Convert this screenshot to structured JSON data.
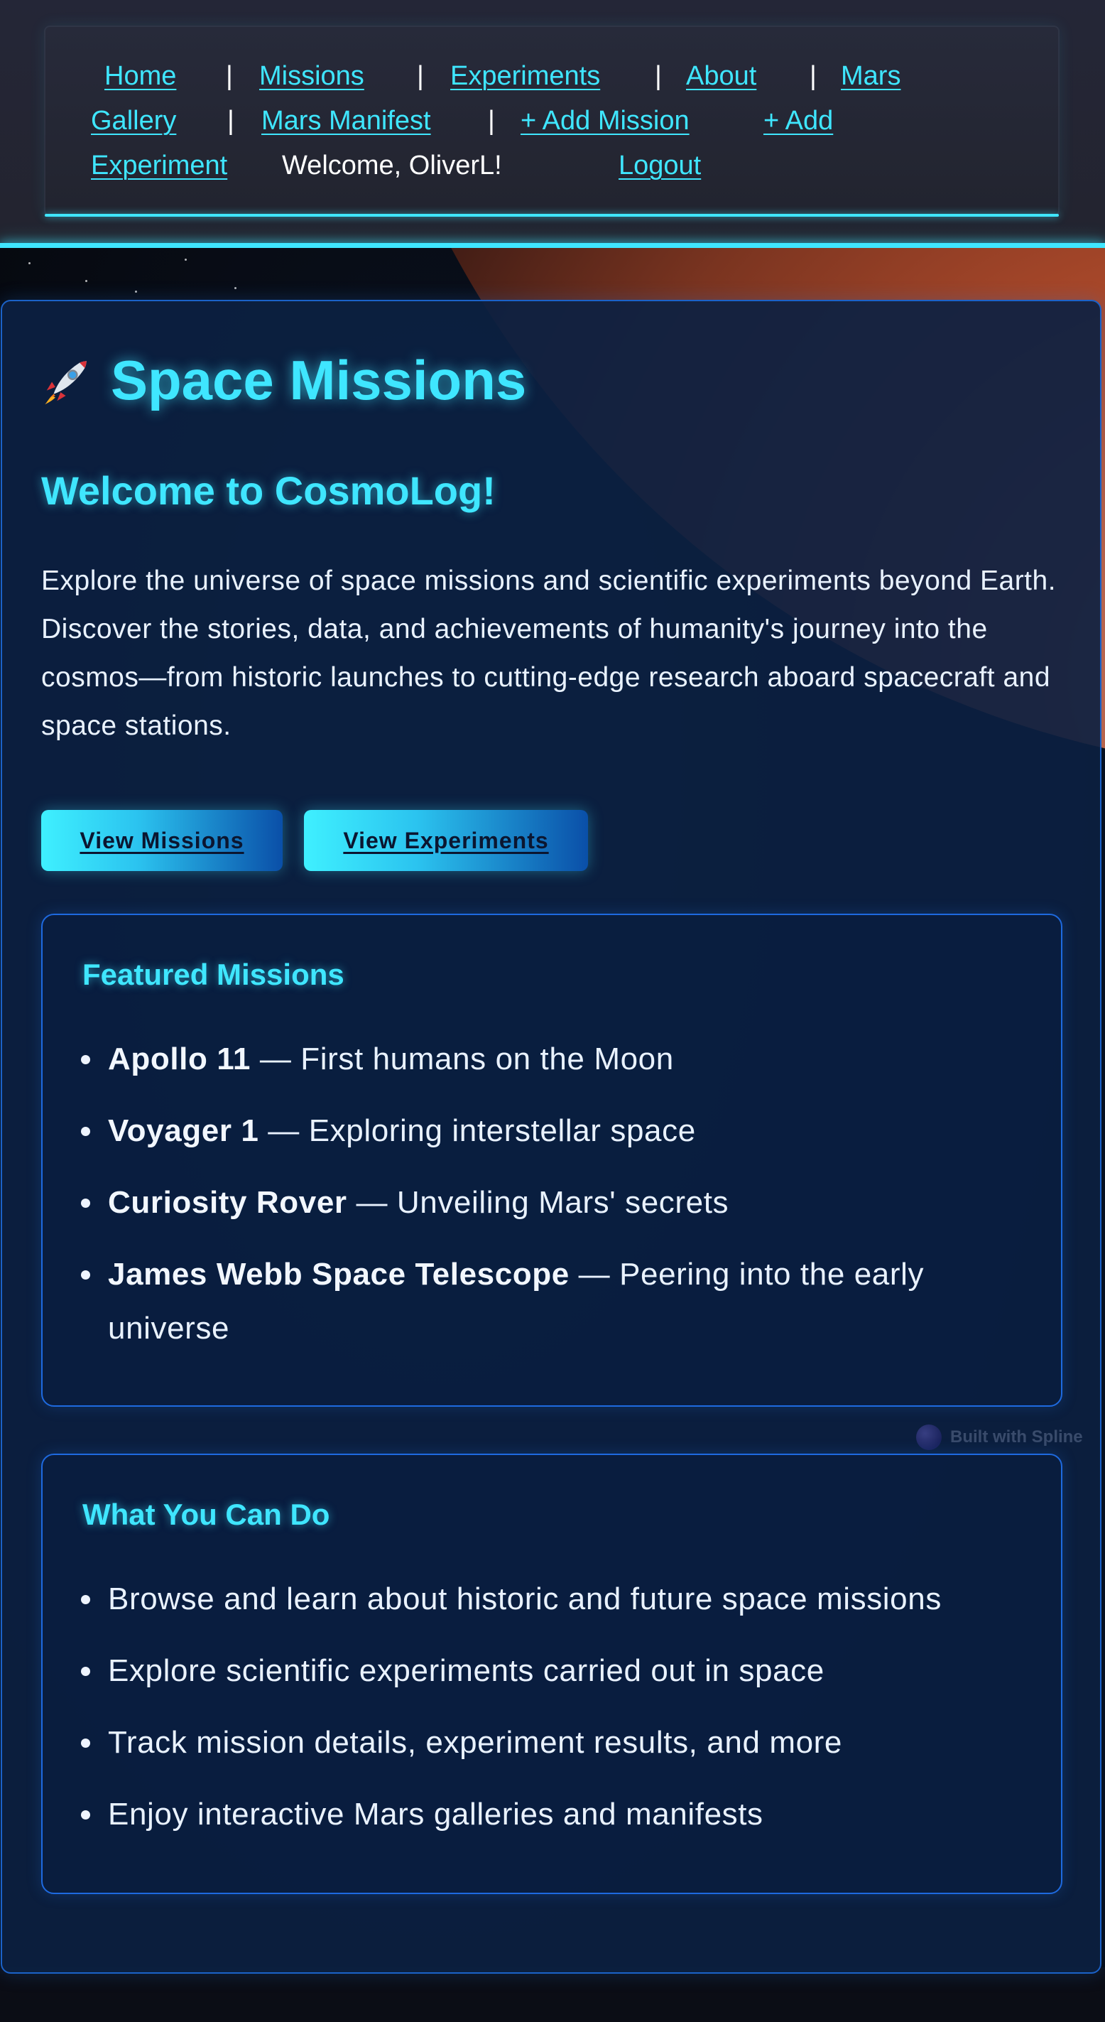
{
  "nav": {
    "home": "Home",
    "missions": "Missions",
    "experiments": "Experiments",
    "about": "About",
    "mars_gallery_1": "Mars",
    "mars_gallery_2": "Gallery",
    "mars_manifest": "Mars Manifest",
    "add_mission": "+ Add Mission",
    "add_experiment_1": "+ Add",
    "add_experiment_2": "Experiment",
    "welcome": "Welcome, OliverL!",
    "logout": "Logout",
    "separator": "|"
  },
  "hero": {
    "title": "Space Missions",
    "title_icon": "rocket-icon",
    "welcome_heading": "Welcome to CosmoLog!",
    "intro": "Explore the universe of space missions and scientific experiments beyond Earth. Discover the stories, data, and achievements of humanity's journey into the cosmos—from historic launches to cutting-edge research aboard spacecraft and space stations."
  },
  "buttons": {
    "view_missions": "View Missions",
    "view_experiments": "View Experiments"
  },
  "featured": {
    "heading": "Featured Missions",
    "items": [
      {
        "name": "Apollo 11",
        "desc": " — First humans on the Moon"
      },
      {
        "name": "Voyager 1",
        "desc": " — Exploring interstellar space"
      },
      {
        "name": "Curiosity Rover",
        "desc": " — Unveiling Mars' secrets"
      },
      {
        "name": "James Webb Space Telescope",
        "desc": " — Peering into the early",
        "desc2": "universe"
      }
    ]
  },
  "what_you_can_do": {
    "heading": "What You Can Do",
    "items": [
      "Browse and learn about historic and future space missions",
      "Explore scientific experiments carried out in space",
      "Track mission details, experiment results, and more",
      "Enjoy interactive Mars galleries and manifests"
    ]
  },
  "badge": {
    "text": "Built with Spline"
  },
  "colors": {
    "accent": "#3fe6ff",
    "panel_border": "#1e6ae0",
    "panel_bg": "#0c2142",
    "header_bg": "#242637",
    "text": "#e9f2ff"
  }
}
